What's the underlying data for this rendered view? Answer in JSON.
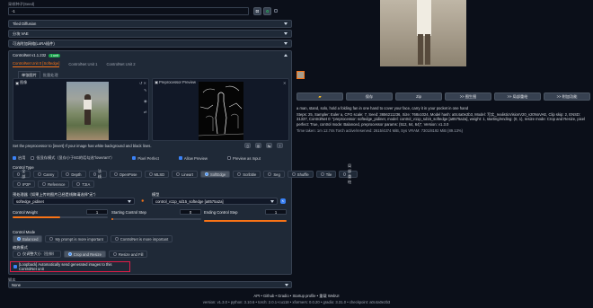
{
  "top": {
    "prompt_label": "采样种子(Seed)",
    "seed_value": "-1"
  },
  "accordions": {
    "tiled_diffusion": "Tiled Diffusion",
    "tiled_vae": "分块 VAE",
    "dynamic_thresholding": "可选附加网络(LoRA插件)"
  },
  "controlnet": {
    "header": "ControlNet v1.1.232",
    "badge": "1 unit",
    "tabs": [
      "ControlNet Unit 0 [Softedge]",
      "ControlNet Unit 1",
      "ControlNet Unit 2"
    ],
    "subtabs": [
      "单张图片",
      "批量处理"
    ],
    "image_label": "图像",
    "preview_label": "Preprocessor Preview",
    "canvas_hint": "Set the preprocessor to [invert] If your image has white background and black lines.",
    "checks": {
      "enable": "启用",
      "low_vram": "低显存模式（显存小于6G的话勾选\"lowvram\"）",
      "pixel_perfect": "Pixel Perfect",
      "allow_preview": "Allow Preview",
      "preview_as_input": "Preview as Input"
    },
    "control_type_label": "Control Type",
    "control_types_row1": [
      "全部",
      "Canny",
      "Depth",
      "法线",
      "OpenPose",
      "MLSD",
      "Lineart",
      "SoftEdge",
      "Scribble",
      "Seg",
      "Shuffle",
      "Tile",
      "局部重绘"
    ],
    "control_types_row2": [
      "IP2P",
      "Reference",
      "T2IA"
    ],
    "selected_type": "SoftEdge",
    "preprocessor_label": "预处理器（如果上传的图片已经是线稿请选择\"无\"）",
    "preprocessor_value": "softedge_pidinet",
    "model_label": "模型",
    "model_value": "control_v11p_sd15_softedge [a8575a2a]",
    "weight_label": "Control Weight",
    "weight_value": "1",
    "start_label": "Starting Control Step",
    "start_value": "0",
    "end_label": "Ending Control Step",
    "end_value": "1",
    "mode_label": "Control Mode",
    "modes": [
      "Balanced",
      "My prompt is more important",
      "ControlNet is more important"
    ],
    "resize_label": "缩放模式",
    "resize_modes": [
      "仅调整大小（拉伸）",
      "Crop and Resize",
      "Resize and Fill"
    ],
    "loopback": "[Loopback] Automatically send generated images to this ControlNet unit",
    "script_label": "脚本",
    "script_value": "None"
  },
  "right": {
    "action_buttons": [
      "",
      "保存",
      "Zip",
      ">> 图生图",
      ">> 局部重绘",
      ">> 附加功能"
    ],
    "info_line1": "a man, stand, solo, hold a folding fan in one hand to cover your face, carry it in your pocket in one hand",
    "info_line2": "Steps: 25, Sampler: Euler a, CFG scale: 7, Seed: 3656211236, Size: 768x1024, Model hash: a0c4a0e2b3, Model: 写实_realisticVisionV20_v20NoVAE, Clip skip: 2, ENSD: 31337, ControlNet 0: \"preprocessor: softedge_pidinet, model: control_v11p_sd15_softedge [a8575a2a], weight: 1, starting/ending: (0, 1), resize mode: Crop and Resize, pixel perfect: True, control mode: Balanced, preprocessor params: (512, 64, 64)\", Version: v1.3.0",
    "info_line3": "Time taken: 1m 12.74s  Torch active/reserved: 2615/4374 MiB, Sys VRAM: 7301/8192 MiB (89.13%)"
  },
  "footer": {
    "links": "API  •  Github  •  Gradio  •  Startup profile  •  重载 WebUI",
    "versions": "version: v1.3.0  •  python: 3.10.6  •  torch: 2.0.1+cu118  •  xformers: 0.0.20  •  gradio: 3.31.0  •  checkpoint: a0c4a0e2b3"
  },
  "colors": {
    "bg": "#0b0f19",
    "panel": "#1f2937",
    "accent": "#f97316",
    "highlight": "#e11d48",
    "link_green": "#22c55e"
  }
}
